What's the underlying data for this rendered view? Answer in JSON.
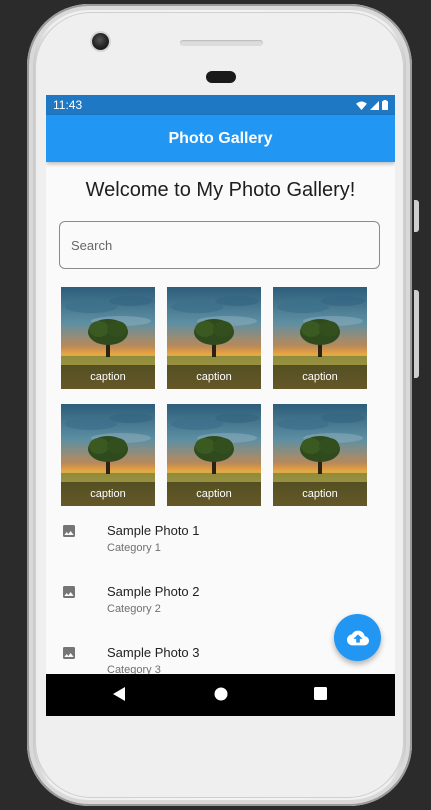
{
  "status_bar": {
    "time": "11:43"
  },
  "app_bar": {
    "title": "Photo Gallery"
  },
  "welcome": {
    "text": "Welcome to My Photo Gallery!"
  },
  "search": {
    "placeholder": "Search",
    "value": ""
  },
  "gallery": {
    "photos": [
      {
        "caption": "caption"
      },
      {
        "caption": "caption"
      },
      {
        "caption": "caption"
      },
      {
        "caption": "caption"
      },
      {
        "caption": "caption"
      },
      {
        "caption": "caption"
      }
    ]
  },
  "list": {
    "items": [
      {
        "title": "Sample Photo 1",
        "subtitle": "Category 1",
        "icon": "image-icon"
      },
      {
        "title": "Sample Photo 2",
        "subtitle": "Category 2",
        "icon": "image-icon"
      },
      {
        "title": "Sample Photo 3",
        "subtitle": "Category 3",
        "icon": "image-icon"
      }
    ]
  },
  "fab": {
    "icon": "cloud-upload-icon"
  },
  "nav_bar": {
    "icons": [
      "back-icon",
      "home-icon",
      "recents-icon"
    ]
  },
  "colors": {
    "primary": "#2196f3",
    "status_bar": "#1e78c4",
    "background": "#fafafa"
  }
}
